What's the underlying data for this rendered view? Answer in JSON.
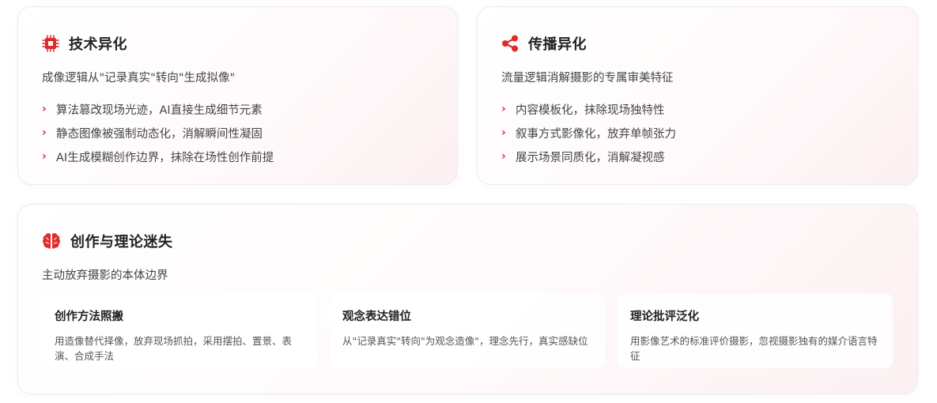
{
  "cards": {
    "tech": {
      "icon": "cpu-chip-icon",
      "title": "技术异化",
      "subtitle": "成像逻辑从\"记录真实\"转向\"生成拟像\"",
      "bullets": [
        "算法篡改现场光迹，AI直接生成细节元素",
        "静态图像被强制动态化，消解瞬间性凝固",
        "AI生成模糊创作边界，抹除在场性创作前提"
      ]
    },
    "spread": {
      "icon": "share-nodes-icon",
      "title": "传播异化",
      "subtitle": "流量逻辑消解摄影的专属审美特征",
      "bullets": [
        "内容模板化，抹除现场独特性",
        "叙事方式影像化，放弃单帧张力",
        "展示场景同质化，消解凝视感"
      ]
    },
    "theory": {
      "icon": "brain-icon",
      "title": "创作与理论迷失",
      "subtitle": "主动放弃摄影的本体边界",
      "boxes": [
        {
          "title": "创作方法照搬",
          "text": "用造像替代择像，放弃现场抓拍，采用摆拍、置景、表演、合成手法"
        },
        {
          "title": "观念表达错位",
          "text": "从\"记录真实\"转向\"为观念造像\"，理念先行，真实感缺位"
        },
        {
          "title": "理论批评泛化",
          "text": "用影像艺术的标准评价摄影，忽视摄影独有的媒介语言特征"
        }
      ]
    }
  },
  "colors": {
    "accent": "#e02b2b",
    "title": "#222222",
    "text": "#444444"
  },
  "bullet_icon": "chevron-right-icon"
}
